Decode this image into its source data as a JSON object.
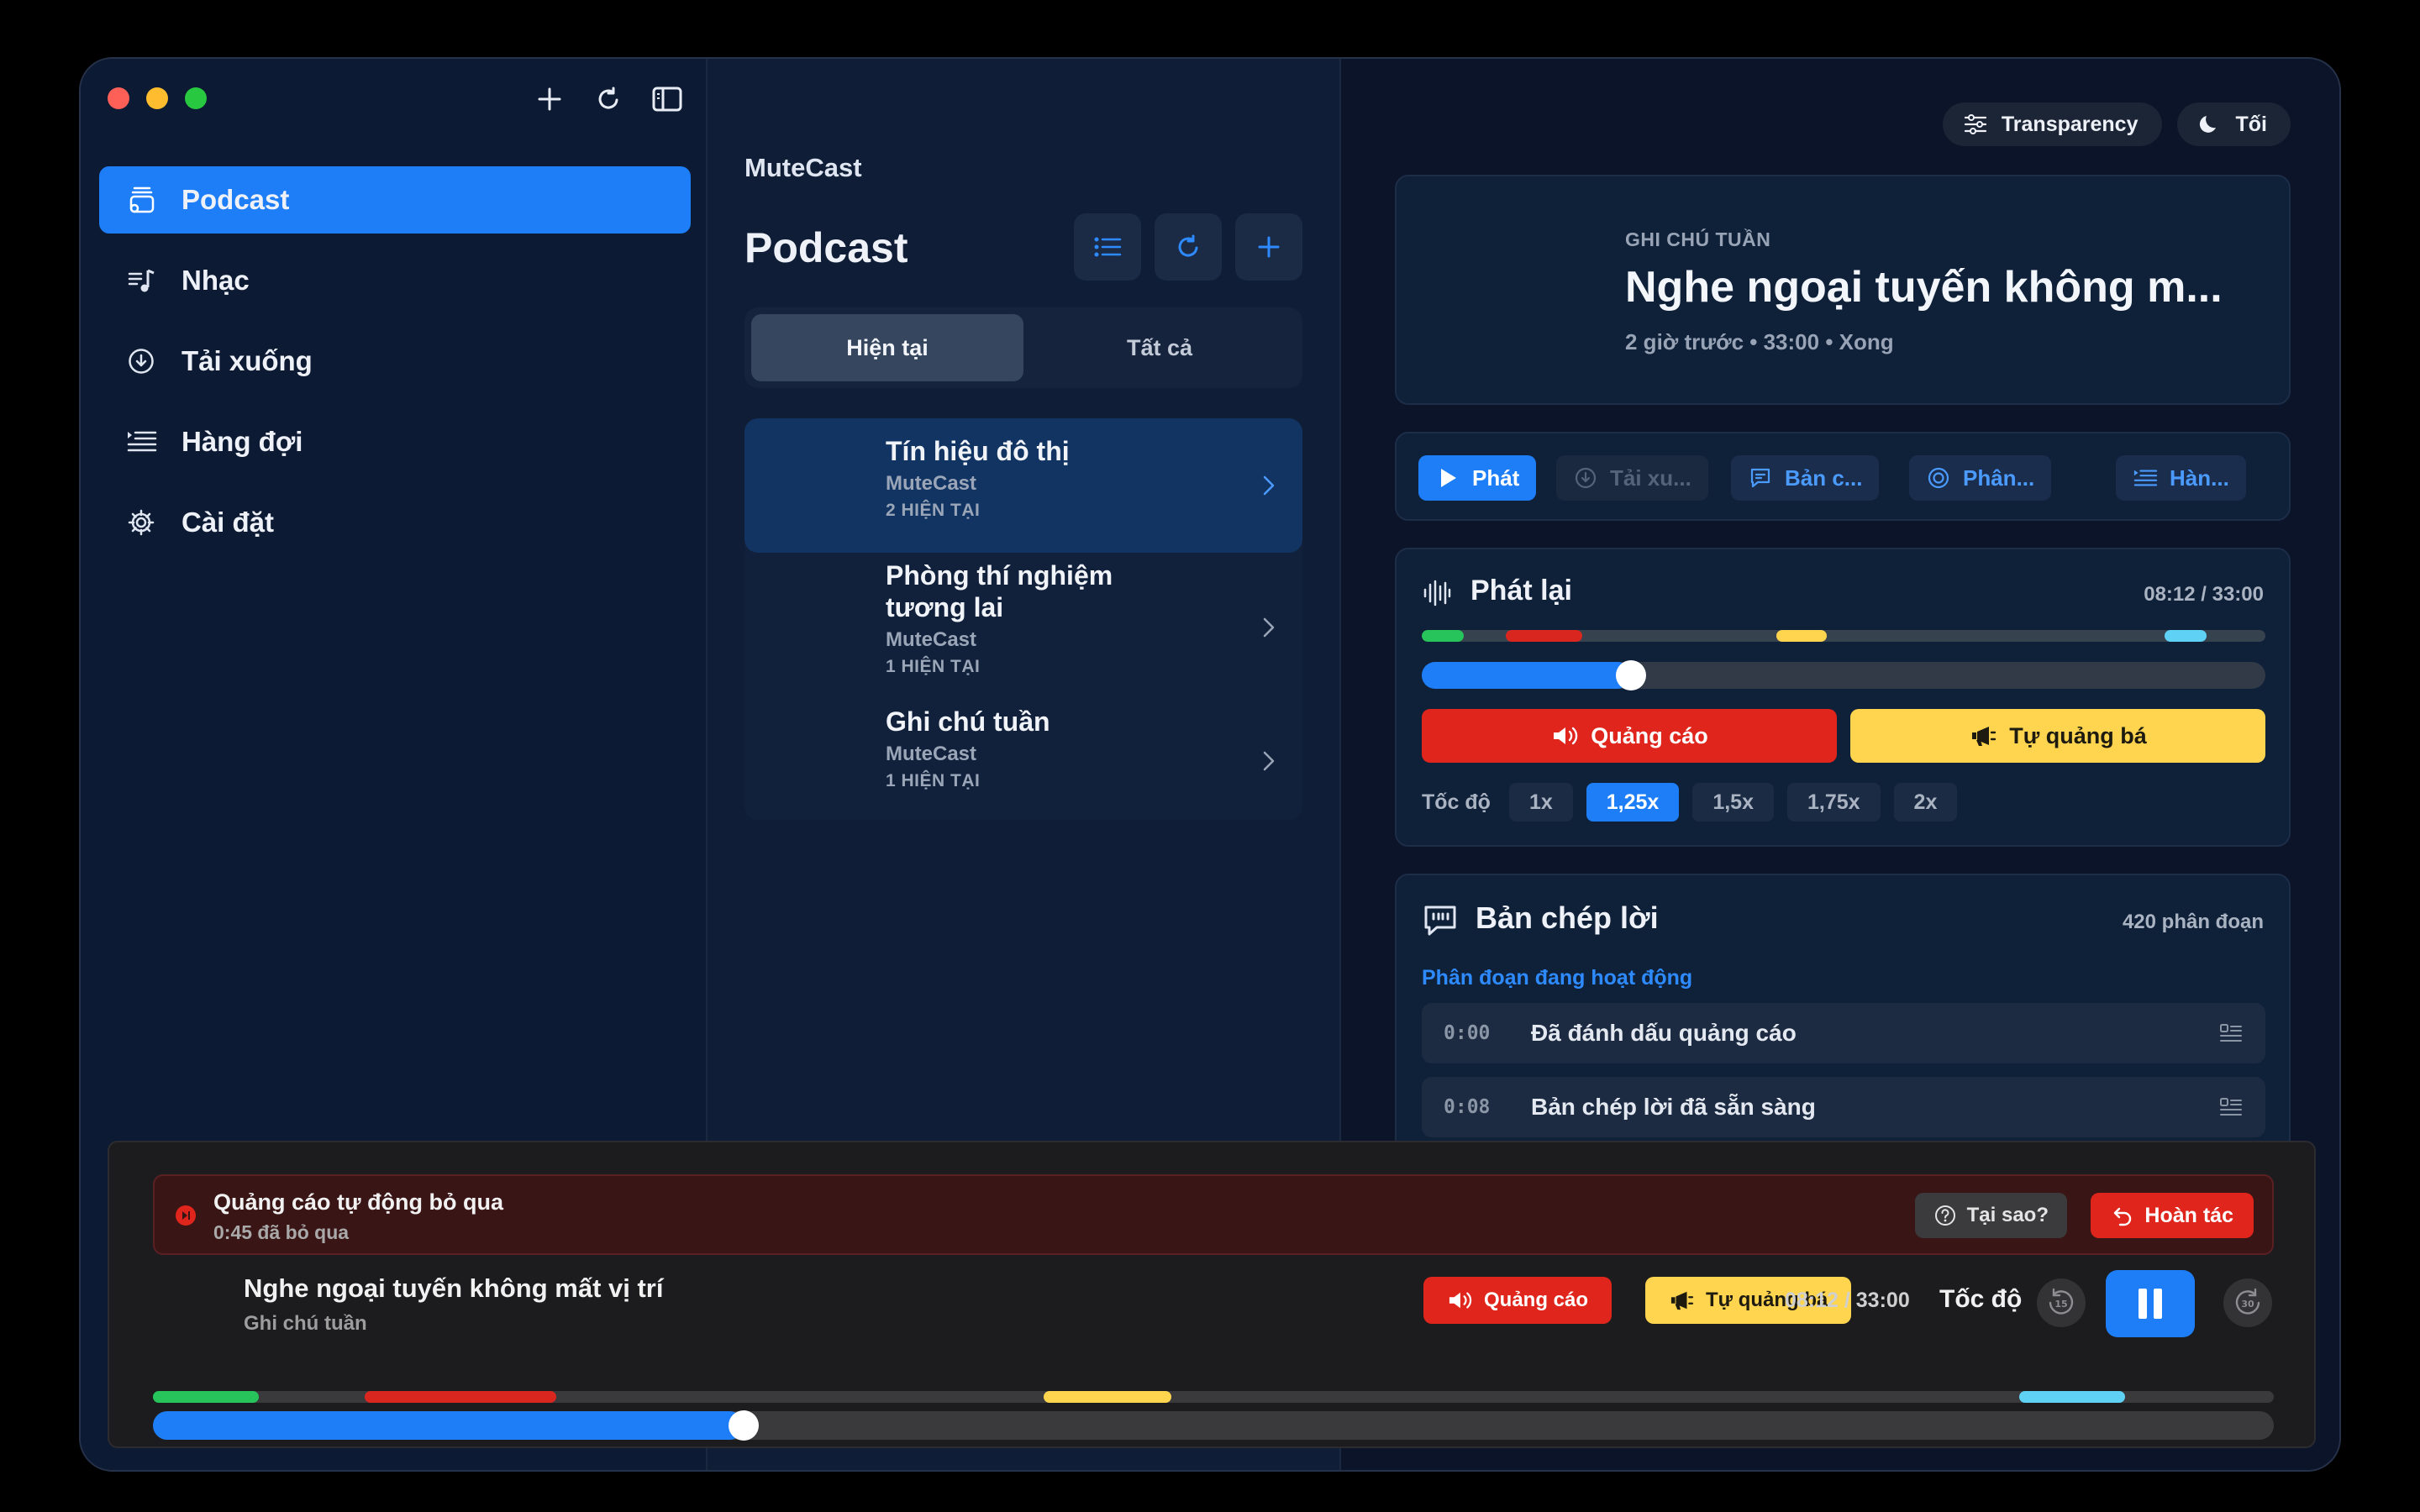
{
  "sidebar": {
    "items": [
      {
        "label": "Podcast",
        "icon": "podcast-icon",
        "active": true
      },
      {
        "label": "Nhạc",
        "icon": "music-icon"
      },
      {
        "label": "Tải xuống",
        "icon": "download-icon"
      },
      {
        "label": "Hàng đợi",
        "icon": "queue-icon"
      },
      {
        "label": "Cài đặt",
        "icon": "gear-icon"
      }
    ]
  },
  "list": {
    "app_name": "MuteCast",
    "title": "Podcast",
    "tabs": [
      "Hiện tại",
      "Tất cả"
    ],
    "episodes": [
      {
        "title": "Tín hiệu đô thị",
        "source": "MuteCast",
        "meta": "2 HIỆN TẠI"
      },
      {
        "title": "Phòng thí nghiệm tương lai",
        "source": "MuteCast",
        "meta": "1 HIỆN TẠI"
      },
      {
        "title": "Ghi chú tuần",
        "source": "MuteCast",
        "meta": "1 HIỆN TẠI"
      }
    ]
  },
  "detail": {
    "pills": {
      "transparency": "Transparency",
      "theme": "Tối"
    },
    "hero": {
      "kicker": "GHI CHÚ TUẦN",
      "title": "Nghe ngoại tuyến không m...",
      "meta": "2 giờ trước • 33:00 • Xong"
    },
    "actions": {
      "play": "Phát",
      "download": "Tải xu...",
      "transcript": "Bản c...",
      "analyze": "Phân...",
      "queue": "Hàn..."
    },
    "playback": {
      "title": "Phát lại",
      "time": "08:12 / 33:00",
      "progress": 0.2485,
      "mark_ad": "Quảng cáo",
      "mark_promo": "Tự quảng bá",
      "speed_label": "Tốc độ",
      "speeds": [
        "1x",
        "1,25x",
        "1,5x",
        "1,75x",
        "2x"
      ],
      "active_speed_index": 1
    },
    "transcript": {
      "title": "Bản chép lời",
      "count": "420 phân đoạn",
      "active_label": "Phân đoạn đang hoạt động",
      "rows": [
        {
          "time": "0:00",
          "text": "Đã đánh dấu quảng cáo"
        },
        {
          "time": "0:08",
          "text": "Bản chép lời đã sẵn sàng"
        }
      ]
    }
  },
  "segments": [
    {
      "type": "green",
      "start": 0.0,
      "end": 0.05
    },
    {
      "type": "red",
      "start": 0.1,
      "end": 0.19
    },
    {
      "type": "yellow",
      "start": 0.42,
      "end": 0.48
    },
    {
      "type": "cyan",
      "start": 0.88,
      "end": 0.93
    }
  ],
  "colors": {
    "accent": "#1e7ef7",
    "ad": "#e0251c",
    "promo": "#ffd54f",
    "green": "#27c35b",
    "red": "#d9271f",
    "yellow": "#ffd54f",
    "cyan": "#5ed1f5"
  },
  "player": {
    "banner_title": "Quảng cáo tự động bỏ qua",
    "banner_sub": "0:45 đã bỏ qua",
    "why": "Tại sao?",
    "undo": "Hoàn tác",
    "title": "Nghe ngoại tuyến không mất vị trí",
    "subtitle": "Ghi chú tuần",
    "mark_ad": "Quảng cáo",
    "mark_promo": "Tự quảng bá",
    "time": "08:12 / 33:00",
    "speed_label": "Tốc độ",
    "progress": 0.2785
  }
}
